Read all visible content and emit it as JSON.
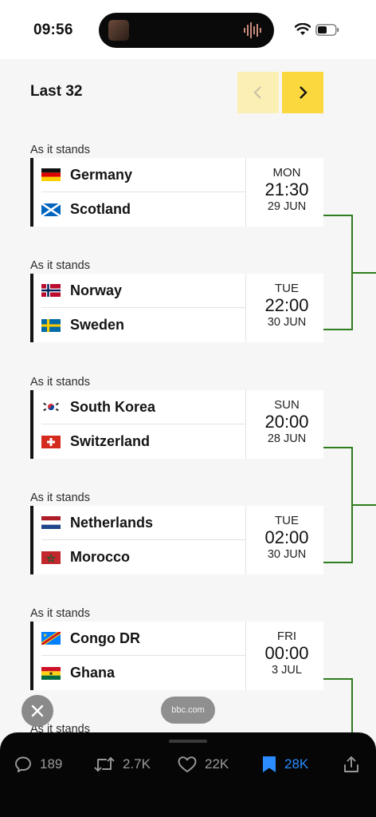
{
  "status_bar": {
    "time": "09:56"
  },
  "header": {
    "round_title": "Last 32",
    "prev_icon": "chevron-left-icon",
    "next_icon": "chevron-right-icon"
  },
  "matches": [
    {
      "label": "As it stands",
      "home": "Germany",
      "away": "Scotland",
      "day": "MON",
      "time": "21:30",
      "date": "29 JUN"
    },
    {
      "label": "As it stands",
      "home": "Norway",
      "away": "Sweden",
      "day": "TUE",
      "time": "22:00",
      "date": "30 JUN"
    },
    {
      "label": "As it stands",
      "home": "South Korea",
      "away": "Switzerland",
      "day": "SUN",
      "time": "20:00",
      "date": "28 JUN"
    },
    {
      "label": "As it stands",
      "home": "Netherlands",
      "away": "Morocco",
      "day": "TUE",
      "time": "02:00",
      "date": "30 JUN"
    },
    {
      "label": "As it stands",
      "home": "Congo DR",
      "away": "Ghana",
      "day": "FRI",
      "time": "00:00",
      "date": "3 JUL"
    }
  ],
  "partial_label": "As it stands",
  "overlay": {
    "url": "bbc.com"
  },
  "actions": {
    "replies": "189",
    "reposts": "2.7K",
    "likes": "22K",
    "bookmarks": "28K"
  },
  "colors": {
    "accent_yellow": "#fbd83e",
    "bracket_green": "#2e7d1e",
    "bookmark_blue": "#2a8cff"
  }
}
